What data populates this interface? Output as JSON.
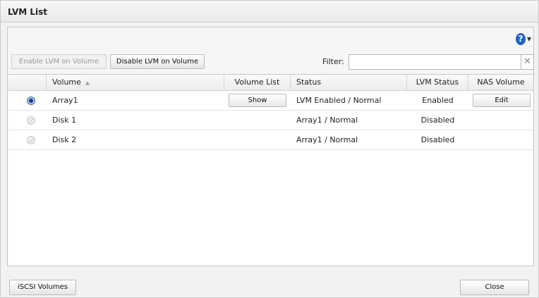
{
  "window": {
    "title": "LVM List"
  },
  "toolbar": {
    "enable_label": "Enable LVM on Volume",
    "disable_label": "Disable LVM on Volume",
    "filter_label": "Filter:",
    "filter_value": "",
    "filter_placeholder": "",
    "help_glyph": "?"
  },
  "table": {
    "columns": [
      "Volume",
      "Volume List",
      "Status",
      "LVM Status",
      "NAS Volume"
    ],
    "sort": {
      "column": "Volume",
      "direction": "ascending"
    },
    "rows": [
      {
        "selected": true,
        "selectable": true,
        "volume": "Array1",
        "volume_list_button": "Show",
        "status": "LVM Enabled / Normal",
        "lvm_status": "Enabled",
        "nas_volume_button": "Edit"
      },
      {
        "selected": false,
        "selectable": false,
        "volume": "Disk 1",
        "volume_list_button": "",
        "status": "Array1 / Normal",
        "lvm_status": "Disabled",
        "nas_volume_button": ""
      },
      {
        "selected": false,
        "selectable": false,
        "volume": "Disk 2",
        "volume_list_button": "",
        "status": "Array1 / Normal",
        "lvm_status": "Disabled",
        "nas_volume_button": ""
      }
    ]
  },
  "footer": {
    "iscsi_label": "iSCSI Volumes",
    "close_label": "Close"
  },
  "icons": {
    "help": "help-circle-icon",
    "clear": "close-x-icon",
    "sort": "sort-ascending-icon",
    "radio_selected": "radio-selected-icon",
    "radio_disabled": "radio-disabled-icon"
  },
  "colors": {
    "accent": "#1f63c6",
    "panel_bg": "#f6f6f6",
    "border": "#c6c6c6"
  }
}
